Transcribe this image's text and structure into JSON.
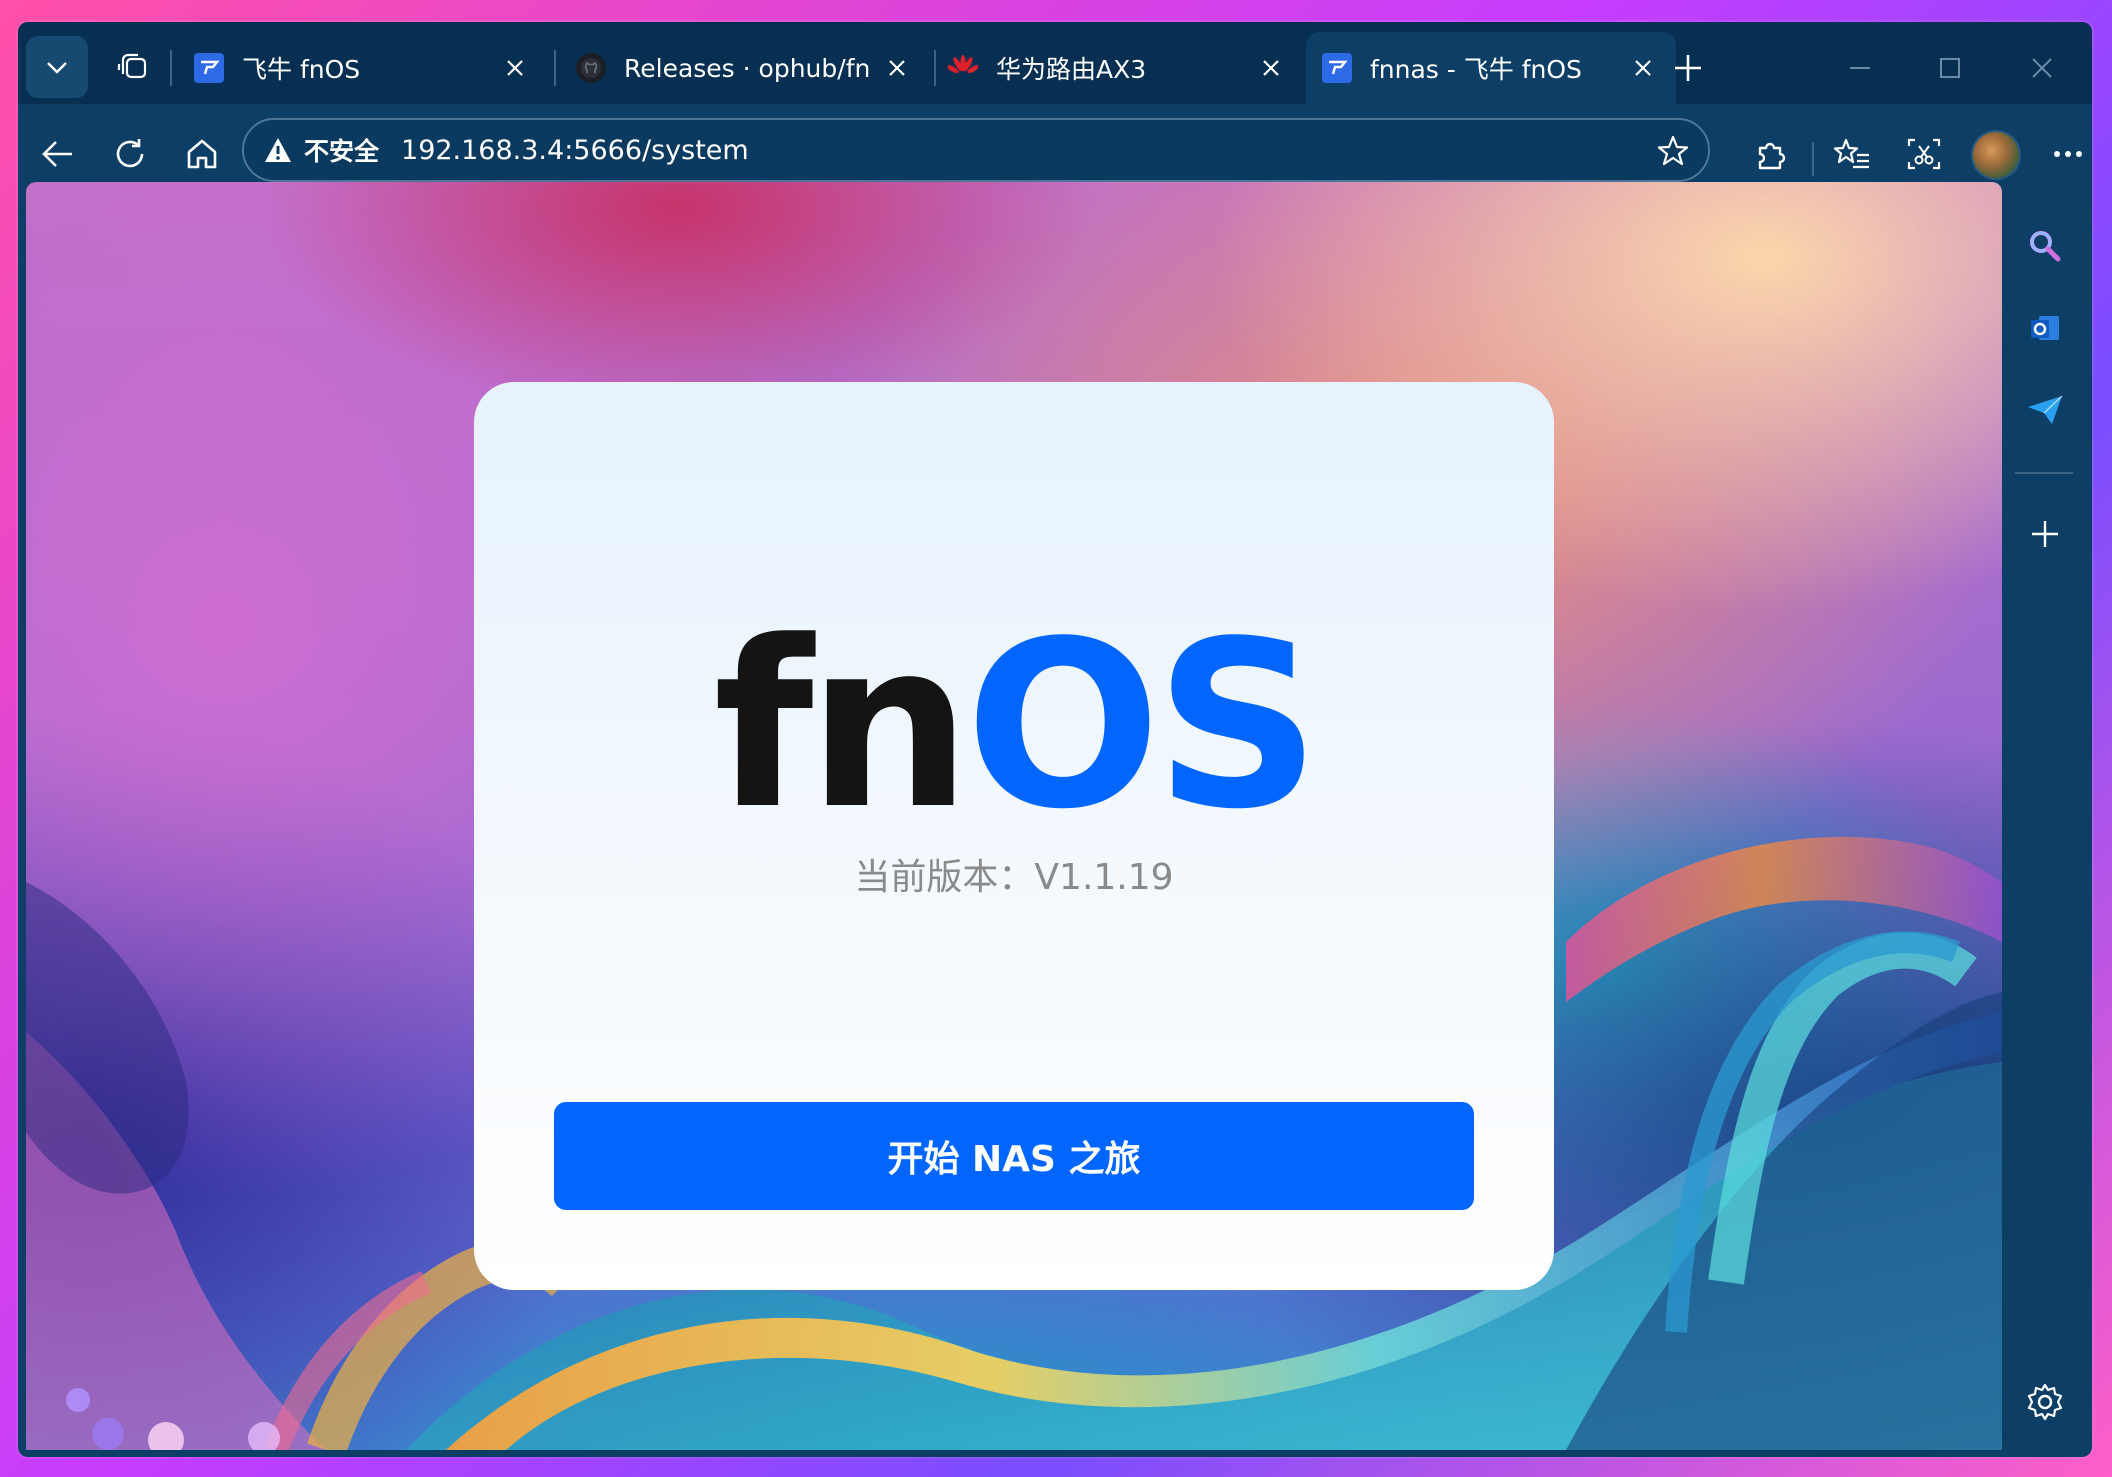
{
  "browser": {
    "tabs": [
      {
        "title": "飞牛 fnOS",
        "icon": "fnos-favicon",
        "active": false
      },
      {
        "title": "Releases · ophub/fnnas ·",
        "icon": "github-favicon",
        "active": false
      },
      {
        "title": "华为路由AX3",
        "icon": "huawei-favicon",
        "active": false
      },
      {
        "title": "fnnas - 飞牛 fnOS",
        "icon": "fnos-favicon",
        "active": true
      }
    ],
    "address_bar": {
      "security_label": "不安全",
      "url": "192.168.3.4:5666/system"
    },
    "colors": {
      "accent": "#0066ff",
      "chrome": "#0d3f66",
      "tabstrip": "#062f52"
    }
  },
  "page": {
    "logo": {
      "part1": "fn",
      "part2": "OS"
    },
    "version_text": "当前版本：V1.1.19",
    "start_button_label": "开始 NAS 之旅"
  }
}
